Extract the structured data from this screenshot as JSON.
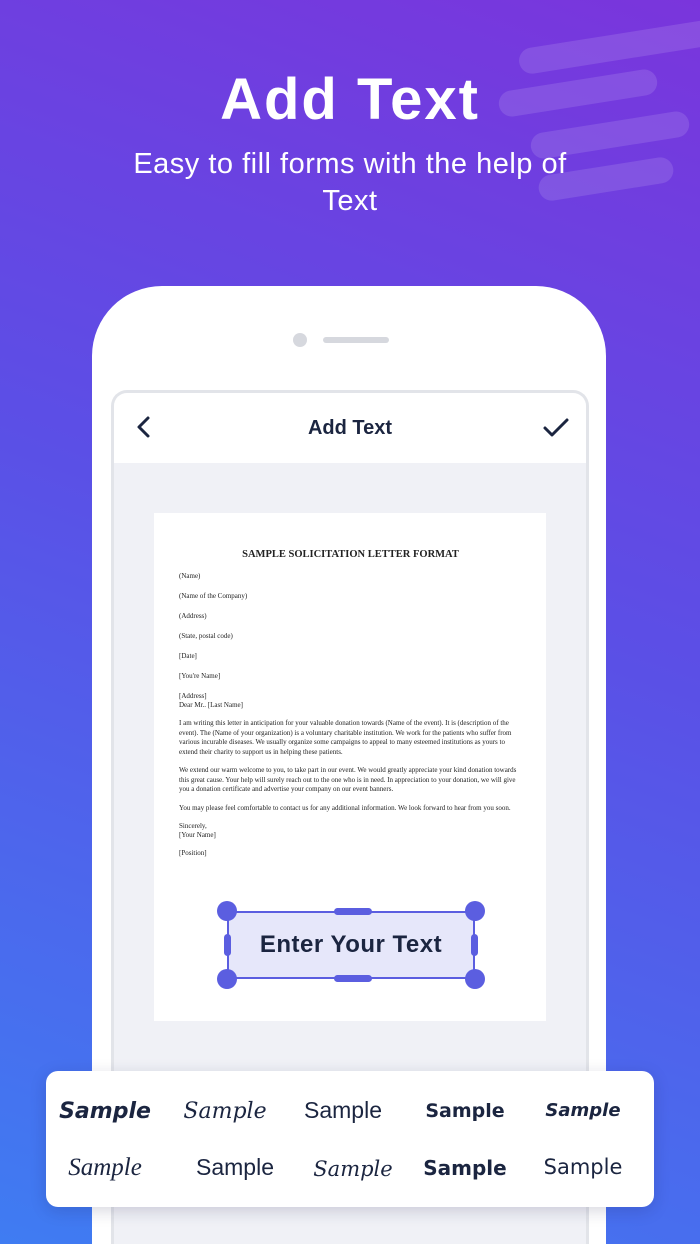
{
  "hero": {
    "title": "Add Text",
    "subtitle": "Easy to fill forms with the help of Text"
  },
  "app_bar": {
    "title": "Add Text",
    "back_icon": "chevron-left-icon",
    "confirm_icon": "checkmark-icon"
  },
  "document": {
    "title": "SAMPLE SOLICITATION LETTER FORMAT",
    "lines": [
      "(Name)",
      "(Name of the Company)",
      "(Address)",
      "(State, postal code)",
      "[Date]",
      "[You're Name]"
    ],
    "address_lines": [
      "[Address]",
      "Dear Mr.. [Last Name]"
    ],
    "paragraphs": [
      "I am writing this letter in anticipation for your valuable donation towards (Name of the event). It is (description of the event). The (Name of your organization) is a voluntary charitable institution. We work for the patients who suffer from various incurable diseases. We usually organize some campaigns to appeal to many esteemed institutions as yours to extend their charity to support us in helping these patients.",
      "We extend our warm welcome to you, to take part in our event. We would greatly appreciate your kind donation towards this great cause. Your help will surely reach out to the one who is in need. In appreciation to your donation, we will give you a donation certificate and advertise your company on our event banners.",
      "You may please feel comfortable to contact us for any additional information. We look forward to hear from you soon."
    ],
    "closing": [
      "Sincerely,",
      "[Your Name]"
    ],
    "position": "[Position]"
  },
  "text_box": {
    "label": "Enter Your Text"
  },
  "font_options": [
    {
      "label": "Sample"
    },
    {
      "label": "Sample"
    },
    {
      "label": "Sample"
    },
    {
      "label": "Sample"
    },
    {
      "label": "Sample"
    },
    {
      "label": "Sample"
    },
    {
      "label": "Sample"
    },
    {
      "label": "Sample"
    },
    {
      "label": "Sample"
    },
    {
      "label": "Sample"
    }
  ],
  "colors": {
    "accent": "#5b5ee0",
    "text_dark": "#1b2540",
    "gradient_top": "#7a35dc",
    "gradient_bottom": "#3f7cf2"
  }
}
